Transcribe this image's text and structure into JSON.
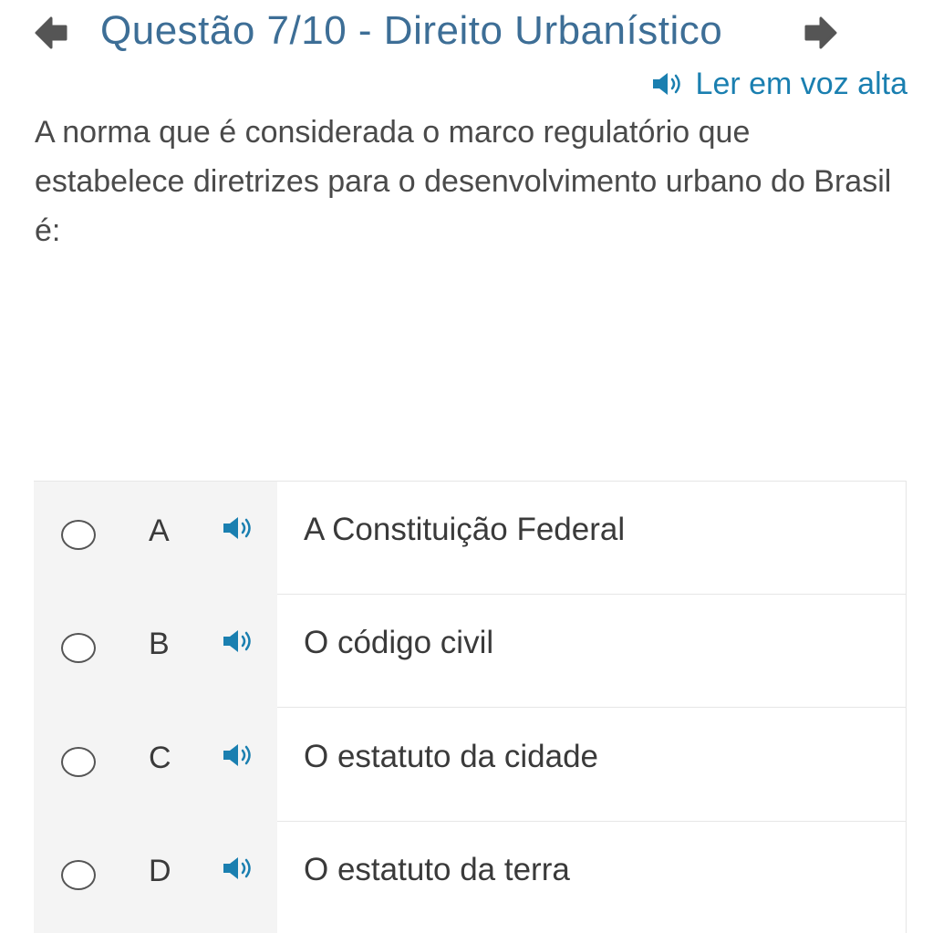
{
  "header": {
    "title": "Questão 7/10 - Direito Urbanístico",
    "prev_icon": "arrow-left-icon",
    "next_icon": "arrow-right-icon"
  },
  "read_aloud": {
    "label": "Ler em voz alta",
    "icon": "speaker-icon"
  },
  "question": {
    "text": "A norma que é considerada o marco regulatório que estabelece diretrizes para o desenvolvimento urbano do Brasil é:"
  },
  "options": [
    {
      "letter": "A",
      "text": "A Constituição Federal",
      "selected": false
    },
    {
      "letter": "B",
      "text": "O código civil",
      "selected": false
    },
    {
      "letter": "C",
      "text": "O estatuto da cidade",
      "selected": false
    },
    {
      "letter": "D",
      "text": "O estatuto da terra",
      "selected": false
    }
  ],
  "colors": {
    "title": "#3d6e96",
    "accent": "#1a7fb0",
    "nav_arrow": "#555555",
    "text": "#3a3a3a",
    "option_label_bg": "#f4f4f4",
    "border": "#e6e6e6"
  }
}
